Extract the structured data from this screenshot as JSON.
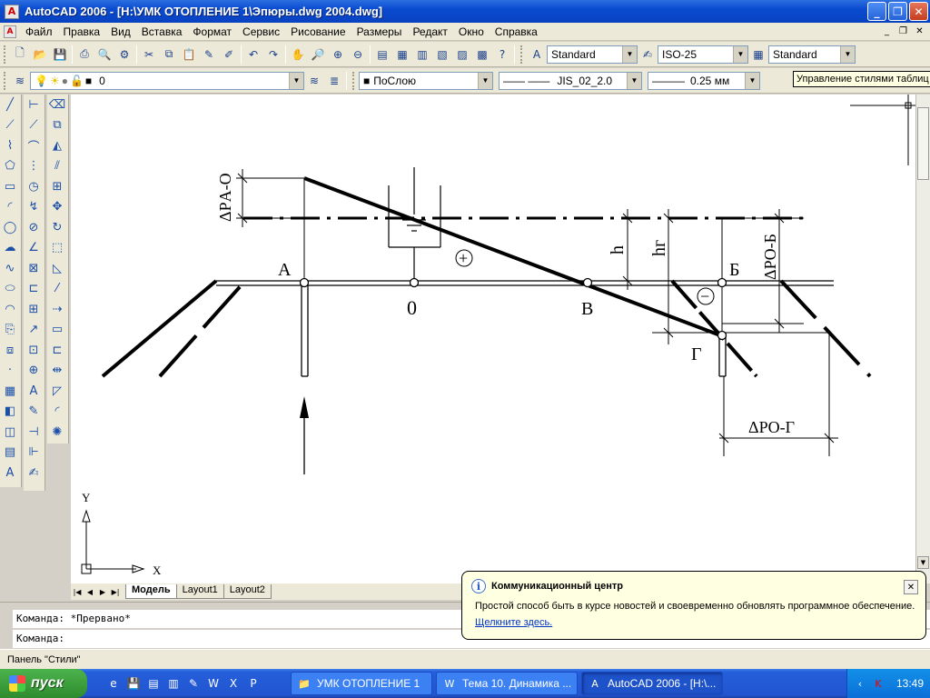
{
  "window": {
    "title": "AutoCAD 2006 - [H:\\УМК ОТОПЛЕНИЕ 1\\Эпюры.dwg 2004.dwg]",
    "minimize": "_",
    "maximize": "❐",
    "close": "✕"
  },
  "menu": [
    "Файл",
    "Правка",
    "Вид",
    "Вставка",
    "Формат",
    "Сервис",
    "Рисование",
    "Размеры",
    "Редакт",
    "Окно",
    "Справка"
  ],
  "toolbar1": {
    "text_style": "Standard",
    "dim_style": "ISO-25",
    "table_style": "Standard"
  },
  "toolbar2": {
    "layer": "0",
    "color": "ПоСлою",
    "linetype": "JIS_02_2.0",
    "lineweight": "0.25 мм"
  },
  "tooltip": "Управление стилями таблиц",
  "drawing_labels": {
    "dp_ao": "ΔPА-О",
    "A": "А",
    "zero": "0",
    "plus": "+",
    "B": "В",
    "h": "h",
    "hg": "hг",
    "Be": "Б",
    "dp_ob": "ΔPО-Б",
    "minus": "−",
    "G": "Г",
    "dp_og": "ΔPО-Г",
    "y_axis": "Y",
    "x_axis": "X"
  },
  "tabs": [
    "Модель",
    "Layout1",
    "Layout2"
  ],
  "command": {
    "line1": "Команда: *Прервано*",
    "line2": "Команда:"
  },
  "status_text": "Панель \"Стили\"",
  "balloon": {
    "title": "Коммуникационный центр",
    "text": "Простой способ быть в курсе новостей и своевременно обновлять программное обеспечение.",
    "link": "Щелкните здесь.",
    "close": "✕"
  },
  "taskbar": {
    "start": "пуск",
    "items": [
      "УМК ОТОПЛЕНИЕ 1",
      "Тема 10. Динамика ...",
      "AutoCAD 2006 - [H:\\..."
    ],
    "clock": "13:49"
  }
}
